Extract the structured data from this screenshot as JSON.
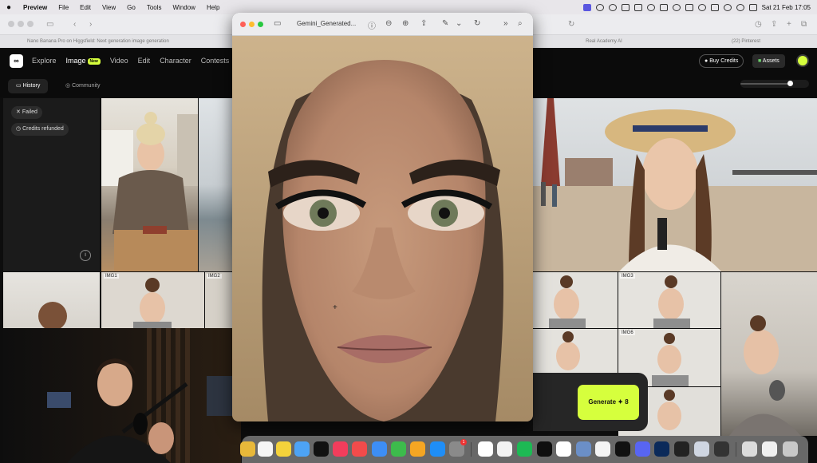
{
  "menubar": {
    "app": "Preview",
    "items": [
      "File",
      "Edit",
      "View",
      "Go",
      "Tools",
      "Window",
      "Help"
    ],
    "clock": "Sat 21 Feb  17:05"
  },
  "browser": {
    "tab_active": "Nano Banana Pro on Higgsfield: Next generation image generation",
    "tab_2": "Real Academy AI",
    "tab_3": "(22) Pinterest"
  },
  "app": {
    "logo": "∞",
    "nav": [
      "Explore",
      "Image",
      "Video",
      "Edit",
      "Character",
      "Contests"
    ],
    "new_badge": "New",
    "buy_credits": "Buy Credits",
    "assets": "Assets",
    "subtabs": [
      "History",
      "Community"
    ],
    "zoom_level": 0.72
  },
  "status": {
    "failed": "Failed",
    "refunded": "Credits refunded"
  },
  "tiles": {
    "img1": "IMG1",
    "img2": "IMG2",
    "img3": "IMG3",
    "img6": "IMG6"
  },
  "preview": {
    "filename": "Gemini_Generated..."
  },
  "generate": {
    "label": "Generate",
    "cost": "✦ 8"
  },
  "dock": {
    "calendar_badge": "1"
  },
  "colors": {
    "accent": "#d6ff3d",
    "app_bg": "#0b0b0b",
    "menubar_active": "#5a57e0"
  }
}
